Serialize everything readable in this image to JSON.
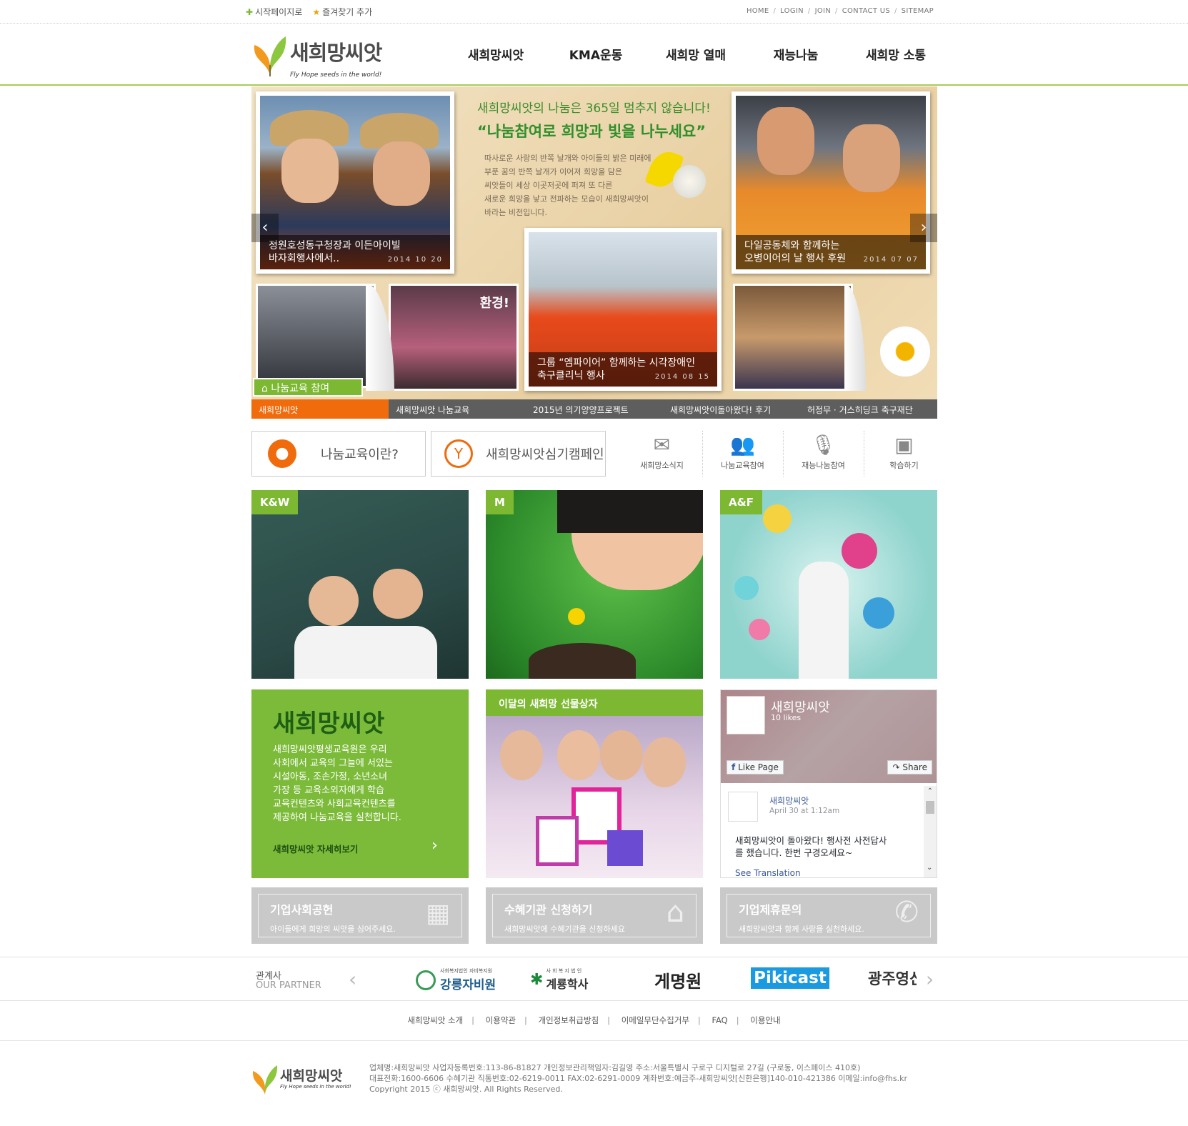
{
  "topbar": {
    "startpage": "시작페이지로",
    "favorite": "즐겨찾기 추가",
    "links": [
      "HOME",
      "LOGIN",
      "JOIN",
      "CONTACT US",
      "SITEMAP"
    ]
  },
  "logo": {
    "name": "새희망씨앗",
    "slogan": "Fly Hope seeds in the world!"
  },
  "nav": [
    "새희망씨앗",
    "KMA운동",
    "새희망 열매",
    "재능나눔",
    "새희망 소통"
  ],
  "hero": {
    "headline1": "새희망씨앗의 나눔은 365일 멈추지 않습니다!",
    "headline2": "“나눔참여로 희망과 빛을 나누세요”",
    "body": "따사로운 사랑의 반쪽 날개와 아이들의 밝은 미래에\n부푼 꿈의 반쪽 날개가 이어져 희망을 담은\n씨앗들이 세상 이곳저곳에 퍼져 또 다른\n새로운 희망을 낳고 전파하는 모습이 새희망씨앗이\n바라는 비전입니다.",
    "photos": [
      {
        "caption": "정원호성동구청장과 이든아이빌\n바자회행사에서..",
        "date": "2014 10 20"
      },
      {
        "caption": "다일공동체와 함께하는\n오병이어의 날 행사 후원",
        "date": "2014 07 07"
      },
      {
        "caption": "그룹 “엠파이어” 함께하는 시각장애인\n축구클리닉 행사",
        "date": "2014 08 15"
      }
    ],
    "badge": "나눔교육 참여",
    "sign_text": "환경!",
    "tabs": [
      "새희망씨앗",
      "새희망씨앗 나눔교육",
      "2015년 의기양양프로젝트",
      "새희망씨앗이돌아왔다! 후기",
      "허정무 · 거스히딩크 축구재단"
    ]
  },
  "quick": {
    "btn1": "나눔교육이란?",
    "btn2": "새희망씨앗심기캠페인",
    "icons": [
      {
        "label": "새희망소식지",
        "icon": "envelope-icon"
      },
      {
        "label": "나눔교육참여",
        "icon": "people-icon"
      },
      {
        "label": "재능나눔참여",
        "icon": "microphone-icon"
      },
      {
        "label": "학습하기",
        "icon": "board-icon"
      }
    ]
  },
  "tiles": [
    {
      "tag": "K&W"
    },
    {
      "tag": "M"
    },
    {
      "tag": "A&F"
    }
  ],
  "promo": {
    "title": "새희망씨앗",
    "text": "새희망씨앗평생교육원은 우리\n사회에서 교육의 그늘에 서있는\n시설아동, 조손가정, 소년소녀\n가장 등 교육소외자에게 학습\n교육컨텐츠와 사회교육컨텐츠를\n제공하여 나눔교육을 실천합니다.",
    "link": "새희망씨앗 자세히보기"
  },
  "gift": {
    "title": "이달의 새희망 선물상자"
  },
  "facebook": {
    "page": "새희망씨앗",
    "likes": "10 likes",
    "like_btn": "Like Page",
    "share_btn": "Share",
    "post_author": "새희망씨앗",
    "post_time": "April 30 at 1:12am",
    "post_text": "새희망씨앗이 돌아왔다! 행사전 사전답사\n를 했습니다. 한번 구경오세요~",
    "see_translation": "See Translation"
  },
  "cta": [
    {
      "title": "기업사회공헌",
      "desc": "아이들에게 희망의 씨앗을 심어주세요."
    },
    {
      "title": "수혜기관 신청하기",
      "desc": "새희망씨앗에 수혜기관을 신청하세요"
    },
    {
      "title": "기업제휴문의",
      "desc": "새희망씨앗과 함께 사랑을 실천하세요."
    }
  ],
  "partners": {
    "label": "관계사",
    "label_en": "OUR PARTNER",
    "logos": [
      "강릉자비원",
      "계룡학사",
      "게명원",
      "Pikicast",
      "광주영신"
    ],
    "logo1_sub": "사회복지법인 자비복지원",
    "logo2_sub": "사 회 복 지 법 인"
  },
  "footer_links": [
    "새희망씨앗 소개",
    "이용약관",
    "개인정보취급방침",
    "이메일무단수집거부",
    "FAQ",
    "이용안내"
  ],
  "footer": {
    "line1": "업체명:새희망씨앗   사업자등록번호:113-86-81827   개인정보관리책임자:김길영   주소:서울특별시 구로구 디지털로 27길 (구로동, 이스페이스 410호)",
    "line2": "대표전화:1600-6606   수혜기관 직통번호:02-6219-0011   FAX:02-6291-0009   계좌번호:예금주-새희망씨앗[신한은행]140-010-421386   이메일:info@fhs.kr",
    "line3": "Copyright 2015 ⓒ 새희망씨앗. All Rights Reserved."
  },
  "colors": {
    "accent_green": "#7cb831",
    "orange": "#f06b0c",
    "text_green": "#2f8f2a"
  }
}
